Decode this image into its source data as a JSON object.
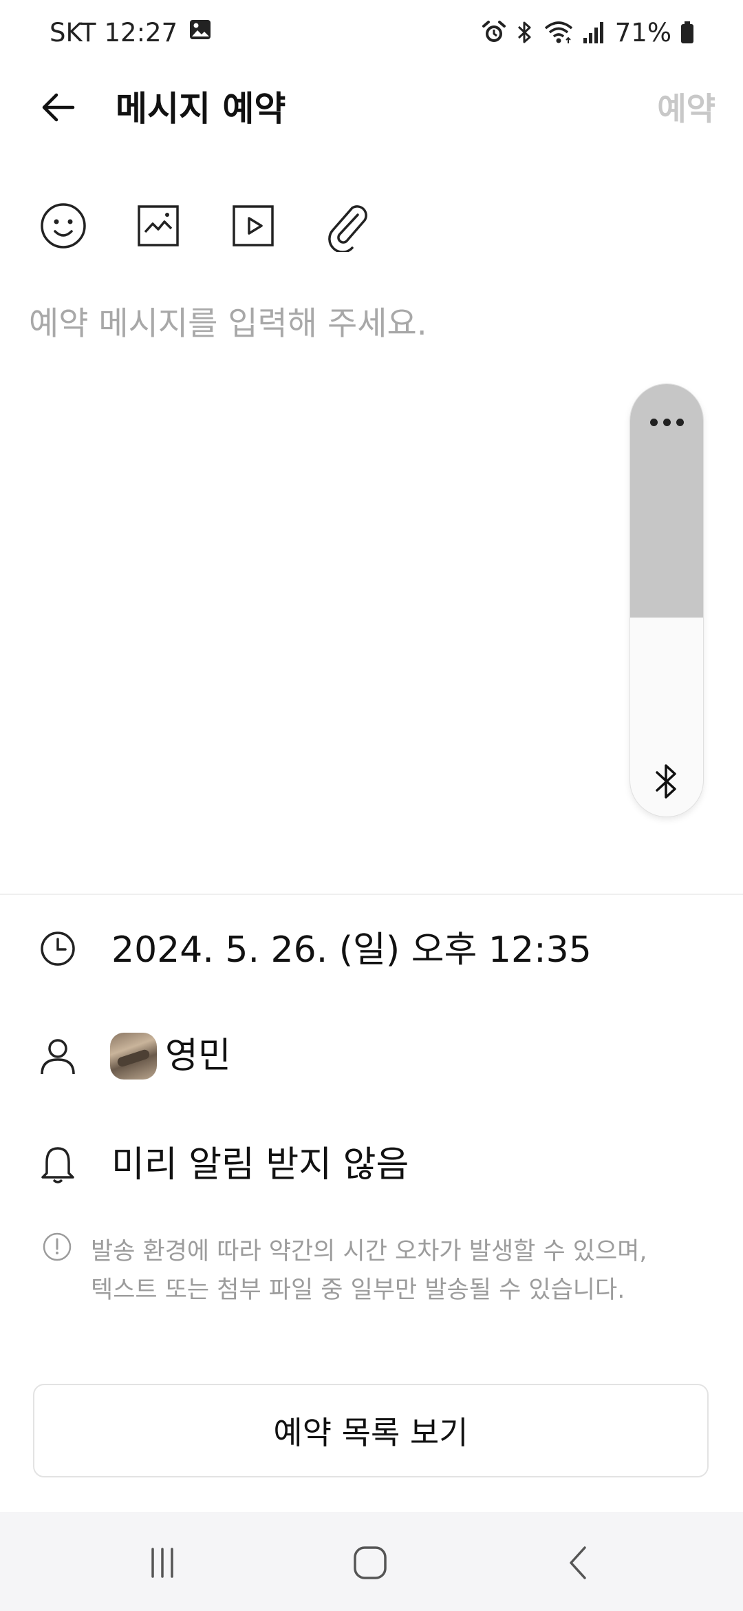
{
  "status_bar": {
    "carrier": "SKT",
    "time": "12:27",
    "battery": "71%",
    "icons": [
      "gallery-icon",
      "alarm-icon",
      "bluetooth-icon",
      "wifi-icon",
      "signal-icon",
      "battery-icon"
    ]
  },
  "app_bar": {
    "title": "메시지 예약",
    "action_label": "예약",
    "action_color": "#c8c8c8"
  },
  "toolbar": {
    "icons": [
      "emoji-icon",
      "image-icon",
      "video-icon",
      "attachment-icon"
    ]
  },
  "message": {
    "placeholder": "예약 메시지를 입력해 주세요.",
    "value": ""
  },
  "volume_panel": {
    "level": 0.54,
    "fill_color": "#c6c6c6",
    "icons": [
      "more-icon",
      "bluetooth-icon"
    ]
  },
  "schedule": {
    "datetime": "2024. 5. 26. (일) 오후 12:35",
    "recipient": "영민",
    "reminder": "미리 알림 받지 않음"
  },
  "notice": {
    "line1": "발송 환경에 따라 약간의 시간 오차가 발생할 수 있으며,",
    "line2": "텍스트 또는 첨부 파일 중 일부만 발송될 수 있습니다."
  },
  "buttons": {
    "list_label": "예약 목록 보기"
  },
  "nav_bar": {
    "icons": [
      "recent-apps-icon",
      "home-icon",
      "back-nav-icon"
    ]
  }
}
